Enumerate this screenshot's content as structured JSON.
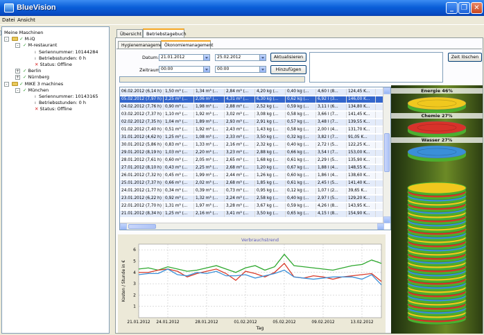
{
  "window": {
    "title": "BlueVision"
  },
  "menu": {
    "items": [
      "Datei",
      "Ansicht"
    ]
  },
  "tree": {
    "rows": [
      {
        "text": "Meine Maschinen",
        "level": 0,
        "mark": "none",
        "expander": "-"
      },
      {
        "text": "M-iQ",
        "level": 1,
        "mark": "check",
        "expander": "-"
      },
      {
        "text": "M-restaurant",
        "level": 2,
        "mark": "check",
        "expander": "-"
      },
      {
        "text": "Seriennummer: 10144284",
        "level": 3,
        "mark": "bullet",
        "expander": ""
      },
      {
        "text": "Betriebsstunden: 0 h",
        "level": 3,
        "mark": "bullet",
        "expander": ""
      },
      {
        "text": "Status: Offline",
        "level": 3,
        "mark": "cross",
        "expander": ""
      },
      {
        "text": "Berlin",
        "level": 2,
        "mark": "check",
        "expander": "+"
      },
      {
        "text": "Nürnberg",
        "level": 2,
        "mark": "check",
        "expander": "+"
      },
      {
        "text": "MIKE 3 machines",
        "level": 1,
        "mark": "check",
        "expander": "-"
      },
      {
        "text": "München",
        "level": 2,
        "mark": "check",
        "expander": "-"
      },
      {
        "text": "Seriennummer: 10143165",
        "level": 3,
        "mark": "bullet",
        "expander": ""
      },
      {
        "text": "Betriebsstunden: 0 h",
        "level": 3,
        "mark": "bullet",
        "expander": ""
      },
      {
        "text": "Status: Offline",
        "level": 3,
        "mark": "cross",
        "expander": ""
      }
    ]
  },
  "tabs_main": [
    "Übersicht",
    "Betriebstagebuch"
  ],
  "tabs_sub": [
    "Hygienemanagement",
    "Ökonomiemanagement"
  ],
  "form": {
    "datum_label": "Datum:",
    "datum_from": "21.01.2012",
    "datum_to": "25.02.2012",
    "zeitraum_label": "Zeitraum:",
    "zeit_from": "00:00",
    "zeit_to": "00:00",
    "btn_refresh": "Aktualisieren",
    "btn_add": "Hinzufügen",
    "btn_clear": "Zeit löschen"
  },
  "grid": {
    "selected_index": 1,
    "rows": [
      [
        "06.02.2012 (6,14 h)",
        "1,50 m³ (...",
        "1,34 m³ (...",
        "2,84 m³ (...",
        "4,20 kg (...",
        "0,40 kg (...",
        "4,60 l (8...",
        "124,45 K..."
      ],
      [
        "05.02.2012 (7,97 h)",
        "2,25 m³ (...",
        "2,06 m³ (...",
        "4,31 m³ (...",
        "6,30 kg (...",
        "0,62 kg (...",
        "6,92 l (3...",
        "146,00 K..."
      ],
      [
        "04.02.2012 (7,76 h)",
        "0,90 m³ (...",
        "1,98 m³ (...",
        "2,88 m³ (...",
        "2,52 kg (...",
        "0,59 kg (...",
        "3,11 l (6...",
        "134,80 K..."
      ],
      [
        "03.02.2012 (7,37 h)",
        "1,10 m³ (...",
        "1,92 m³ (...",
        "3,02 m³ (...",
        "3,08 kg (...",
        "0,58 kg (...",
        "3,66 l (7...",
        "141,45 K..."
      ],
      [
        "02.02.2012 (7,35 h)",
        "1,04 m³ (...",
        "1,89 m³ (...",
        "2,93 m³ (...",
        "2,91 kg (...",
        "0,57 kg (...",
        "3,48 l (7...",
        "139,55 K..."
      ],
      [
        "01.02.2012 (7,40 h)",
        "0,51 m³ (...",
        "1,92 m³ (...",
        "2,43 m³ (...",
        "1,43 kg (...",
        "0,58 kg (...",
        "2,00 l (4...",
        "131,70 K..."
      ],
      [
        "31.01.2012 (4,62 h)",
        "1,25 m³ (...",
        "1,08 m³ (...",
        "2,33 m³ (...",
        "3,50 kg (...",
        "0,32 kg (...",
        "3,82 l (7...",
        "91,05 K..."
      ],
      [
        "30.01.2012 (5,86 h)",
        "0,83 m³ (...",
        "1,33 m³ (...",
        "2,16 m³ (...",
        "2,32 kg (...",
        "0,40 kg (...",
        "2,72 l (5...",
        "122,25 K..."
      ],
      [
        "29.01.2012 (8,19 h)",
        "1,03 m³ (...",
        "2,20 m³ (...",
        "3,23 m³ (...",
        "2,88 kg (...",
        "0,66 kg (...",
        "3,54 l (7...",
        "153,00 K..."
      ],
      [
        "28.01.2012 (7,61 h)",
        "0,60 m³ (...",
        "2,05 m³ (...",
        "2,65 m³ (...",
        "1,68 kg (...",
        "0,61 kg (...",
        "2,29 l (5...",
        "135,90 K..."
      ],
      [
        "27.01.2012 (8,10 h)",
        "0,43 m³ (...",
        "2,25 m³ (...",
        "2,68 m³ (...",
        "1,20 kg (...",
        "0,67 kg (...",
        "1,88 l (4...",
        "148,55 K..."
      ],
      [
        "26.01.2012 (7,32 h)",
        "0,45 m³ (...",
        "1,99 m³ (...",
        "2,44 m³ (...",
        "1,26 kg (...",
        "0,60 kg (...",
        "1,86 l (4...",
        "138,60 K..."
      ],
      [
        "25.01.2012 (7,37 h)",
        "0,66 m³ (...",
        "2,02 m³ (...",
        "2,68 m³ (...",
        "1,85 kg (...",
        "0,61 kg (...",
        "2,45 l (5...",
        "141,40 K..."
      ],
      [
        "24.01.2012 (1,77 h)",
        "0,34 m³ (...",
        "0,39 m³ (...",
        "0,73 m³ (...",
        "0,95 kg (...",
        "0,12 kg (...",
        "1,07 l (2...",
        "39,65 K..."
      ],
      [
        "23.01.2012 (6,22 h)",
        "0,92 m³ (...",
        "1,32 m³ (...",
        "2,24 m³ (...",
        "2,58 kg (...",
        "0,40 kg (...",
        "2,97 l (5...",
        "129,20 K..."
      ],
      [
        "22.01.2012 (7,70 h)",
        "1,31 m³ (...",
        "1,97 m³ (...",
        "3,28 m³ (...",
        "3,67 kg (...",
        "0,59 kg (...",
        "4,26 l (8...",
        "143,95 K..."
      ],
      [
        "21.01.2012 (8,34 h)",
        "1,25 m³ (...",
        "2,16 m³ (...",
        "3,41 m³ (...",
        "3,50 kg (...",
        "0,65 kg (...",
        "4,15 l (8...",
        "154,90 K..."
      ]
    ]
  },
  "coins": {
    "energie_label": "Energie 46%",
    "chemie_label": "Chemie 27%",
    "wasser_label": "Wasser 27%",
    "colors": {
      "energie": "#f0c81e",
      "chemie": "#d8322a",
      "wasser": "#3a8fd8",
      "rim": "#4cae2e"
    }
  },
  "chart_data": {
    "type": "line",
    "title": "Verbrauchstrend",
    "xlabel": "Tag",
    "ylabel": "Kosten / Stunde in €",
    "x_ticks": [
      "21.01.2012",
      "24.01.2012",
      "28.01.2012",
      "01.02.2012",
      "05.02.2012",
      "09.02.2012",
      "13.02.2012"
    ],
    "y_ticks": [
      1,
      2,
      3,
      4,
      5,
      6
    ],
    "ylim": [
      0,
      6.5
    ],
    "xlim": [
      0,
      25
    ],
    "colors": [
      "#2ea82e",
      "#d83a2a",
      "#3a90d8"
    ],
    "series": [
      {
        "x": [
          0,
          1,
          2,
          3,
          4,
          5,
          6,
          7,
          8,
          9,
          10,
          11,
          12,
          13,
          14,
          15,
          16,
          17,
          18,
          19,
          20,
          21,
          22,
          23,
          24,
          25
        ],
        "values": [
          4.3,
          4.4,
          4.2,
          4.5,
          4.3,
          4.1,
          4.2,
          4.4,
          4.6,
          4.3,
          4.0,
          4.4,
          4.6,
          4.2,
          4.5,
          5.6,
          4.6,
          4.5,
          4.4,
          4.3,
          4.2,
          4.4,
          4.6,
          4.7,
          5.1,
          4.8
        ]
      },
      {
        "x": [
          0,
          1,
          2,
          3,
          4,
          5,
          6,
          7,
          8,
          9,
          10,
          11,
          12,
          13,
          14,
          15,
          16,
          17,
          18,
          19,
          20,
          21,
          22,
          23,
          24,
          25
        ],
        "values": [
          4.0,
          4.0,
          4.2,
          4.3,
          4.1,
          3.6,
          3.9,
          4.1,
          4.3,
          3.9,
          3.3,
          4.1,
          3.9,
          3.6,
          4.0,
          4.8,
          3.6,
          3.5,
          3.7,
          3.6,
          3.4,
          3.6,
          3.7,
          3.8,
          3.9,
          3.2
        ]
      },
      {
        "x": [
          0,
          1,
          2,
          3,
          4,
          5,
          6,
          7,
          8,
          9,
          10,
          11,
          12,
          13,
          14,
          15,
          16,
          17,
          18,
          19,
          20,
          21,
          22,
          23,
          24,
          25
        ],
        "values": [
          3.8,
          3.9,
          3.9,
          4.3,
          3.8,
          3.7,
          4.0,
          3.9,
          4.1,
          3.7,
          3.7,
          3.8,
          3.5,
          3.7,
          3.9,
          4.2,
          3.6,
          3.5,
          3.4,
          3.5,
          3.6,
          3.6,
          3.6,
          3.4,
          3.8,
          2.9
        ]
      }
    ]
  }
}
